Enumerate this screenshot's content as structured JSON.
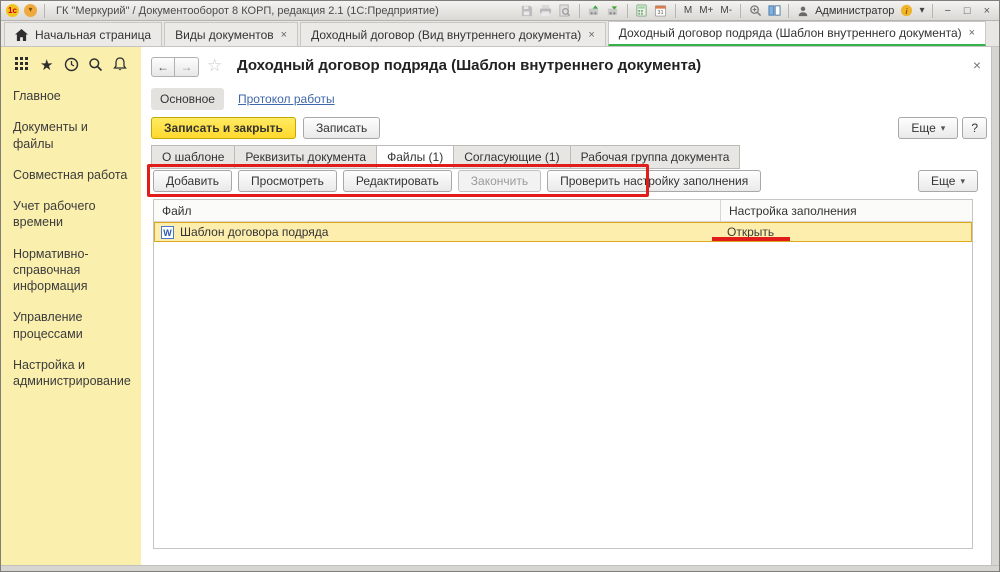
{
  "titlebar": {
    "logo_text": "1с",
    "title": "ГК \"Меркурий\" / Документооборот 8 КОРП, редакция 2.1  (1С:Предприятие)",
    "memory": [
      "M",
      "M+",
      "M-"
    ],
    "user": "Администратор"
  },
  "icons": {
    "close": "×",
    "dropdown": "▾",
    "back": "←",
    "forward": "→",
    "star_outline": "☆",
    "star": "★",
    "minimize": "−",
    "maximize": "□",
    "word": "W"
  },
  "app_tabs": {
    "home": {
      "label": "Начальная страница"
    },
    "tabs": [
      {
        "label": "Виды документов"
      },
      {
        "label": "Доходный договор (Вид внутреннего документа)"
      },
      {
        "label": "Доходный договор подряда (Шаблон внутреннего документа)"
      }
    ]
  },
  "sidebar": {
    "items": [
      "Главное",
      "Документы и файлы",
      "Совместная работа",
      "Учет рабочего времени",
      "Нормативно-справочная информация",
      "Управление процессами",
      "Настройка и администрирование"
    ]
  },
  "form": {
    "title": "Доходный договор подряда (Шаблон внутреннего документа)",
    "nav_main": "Основное",
    "nav_protocol": "Протокол работы",
    "btn_save_close": "Записать и закрыть",
    "btn_save": "Записать",
    "btn_more": "Еще",
    "btn_help": "?",
    "tabs": [
      "О шаблоне",
      "Реквизиты документа",
      "Файлы (1)",
      "Согласующие (1)",
      "Рабочая группа документа"
    ],
    "active_tab": "Файлы (1)",
    "toolbar": {
      "add": "Добавить",
      "view": "Просмотреть",
      "edit": "Редактировать",
      "finish": "Закончить",
      "check": "Проверить настройку заполнения",
      "more": "Еще"
    },
    "table": {
      "col_file": "Файл",
      "col_setting": "Настройка заполнения",
      "rows": [
        {
          "file": "Шаблон договора подряда",
          "setting": "Открыть"
        }
      ]
    }
  },
  "colors": {
    "accent_green": "#35b34a",
    "sidebar_yellow": "#faefad",
    "button_yellow": "#ffd92e",
    "annotation_red": "#e21b1b",
    "selected_row_bg": "#fdeeae",
    "selected_row_border": "#dda81c"
  }
}
